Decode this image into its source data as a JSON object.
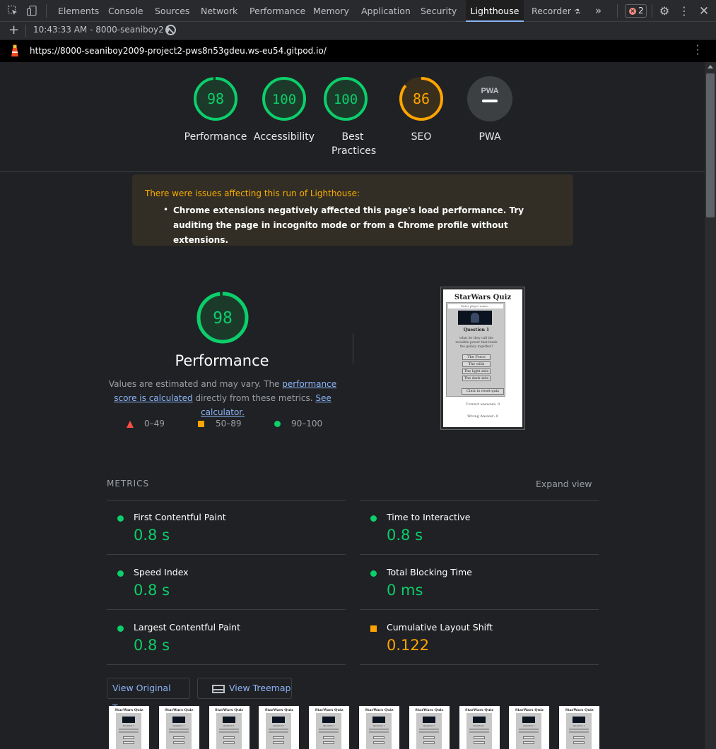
{
  "devtools": {
    "tabs": [
      "Elements",
      "Console",
      "Sources",
      "Network",
      "Performance",
      "Memory",
      "Application",
      "Security",
      "Lighthouse",
      "Recorder"
    ],
    "active_tab": "Lighthouse",
    "more_tabs_icon": "chevron-double-right-icon",
    "error_count": "2"
  },
  "report_toolbar": {
    "run_label": "10:43:33 AM - 8000-seaniboy2"
  },
  "url_bar": {
    "url": "https://8000-seaniboy2009-project2-pws8n53gdeu.ws-eu54.gitpod.io/"
  },
  "scores": [
    {
      "label": "Performance",
      "value": "98",
      "score": 98,
      "color": "#0cce6b"
    },
    {
      "label": "Accessibility",
      "value": "100",
      "score": 100,
      "color": "#0cce6b"
    },
    {
      "label": "Best Practices",
      "value": "100",
      "score": 100,
      "color": "#0cce6b"
    },
    {
      "label": "SEO",
      "value": "86",
      "score": 86,
      "color": "#ffa400"
    },
    {
      "label": "PWA",
      "value": "PWA",
      "score": null,
      "color": "#9aa0a6"
    }
  ],
  "warning": {
    "title": "There were issues affecting this run of Lighthouse:",
    "items": [
      "Chrome extensions negatively affected this page's load performance. Try auditing the page in incognito mode or from a Chrome profile without extensions."
    ]
  },
  "performance": {
    "score": "98",
    "title": "Performance",
    "desc_prefix": "Values are estimated and may vary. The ",
    "desc_link1": "performance score is calculated",
    "desc_mid": " directly from these metrics. ",
    "desc_link2": "See calculator.",
    "legend": [
      {
        "range": "0–49",
        "color": "#ff4e42"
      },
      {
        "range": "50–89",
        "color": "#ffa400"
      },
      {
        "range": "90–100",
        "color": "#0cce6b"
      }
    ]
  },
  "screenshot": {
    "title": "StarWars Quiz",
    "name_placeholder": "Enter player name...",
    "question": "Question 1",
    "question_text": "what do they call the invisible power that binds the galaxy together?",
    "answers": [
      "The Force",
      "The wills",
      "The light side",
      "The dark side"
    ],
    "reset": "Click to reset quiz",
    "correct": "Correct answers: 0",
    "wrong": "Wrong Answer: 0"
  },
  "metrics": {
    "heading": "METRICS",
    "expand": "Expand view",
    "items": [
      {
        "name": "First Contentful Paint",
        "value": "0.8 s",
        "rating": "pass"
      },
      {
        "name": "Time to Interactive",
        "value": "0.8 s",
        "rating": "pass"
      },
      {
        "name": "Speed Index",
        "value": "0.8 s",
        "rating": "pass"
      },
      {
        "name": "Total Blocking Time",
        "value": "0 ms",
        "rating": "pass"
      },
      {
        "name": "Largest Contentful Paint",
        "value": "0.8 s",
        "rating": "pass"
      },
      {
        "name": "Cumulative Layout Shift",
        "value": "0.122",
        "rating": "average"
      }
    ]
  },
  "buttons": {
    "view_trace": "View Original Trace",
    "view_treemap": "View Treemap"
  },
  "colors": {
    "pass": "#0cce6b",
    "average": "#ffa400",
    "fail": "#ff4e42",
    "link": "#8ab4f8"
  }
}
